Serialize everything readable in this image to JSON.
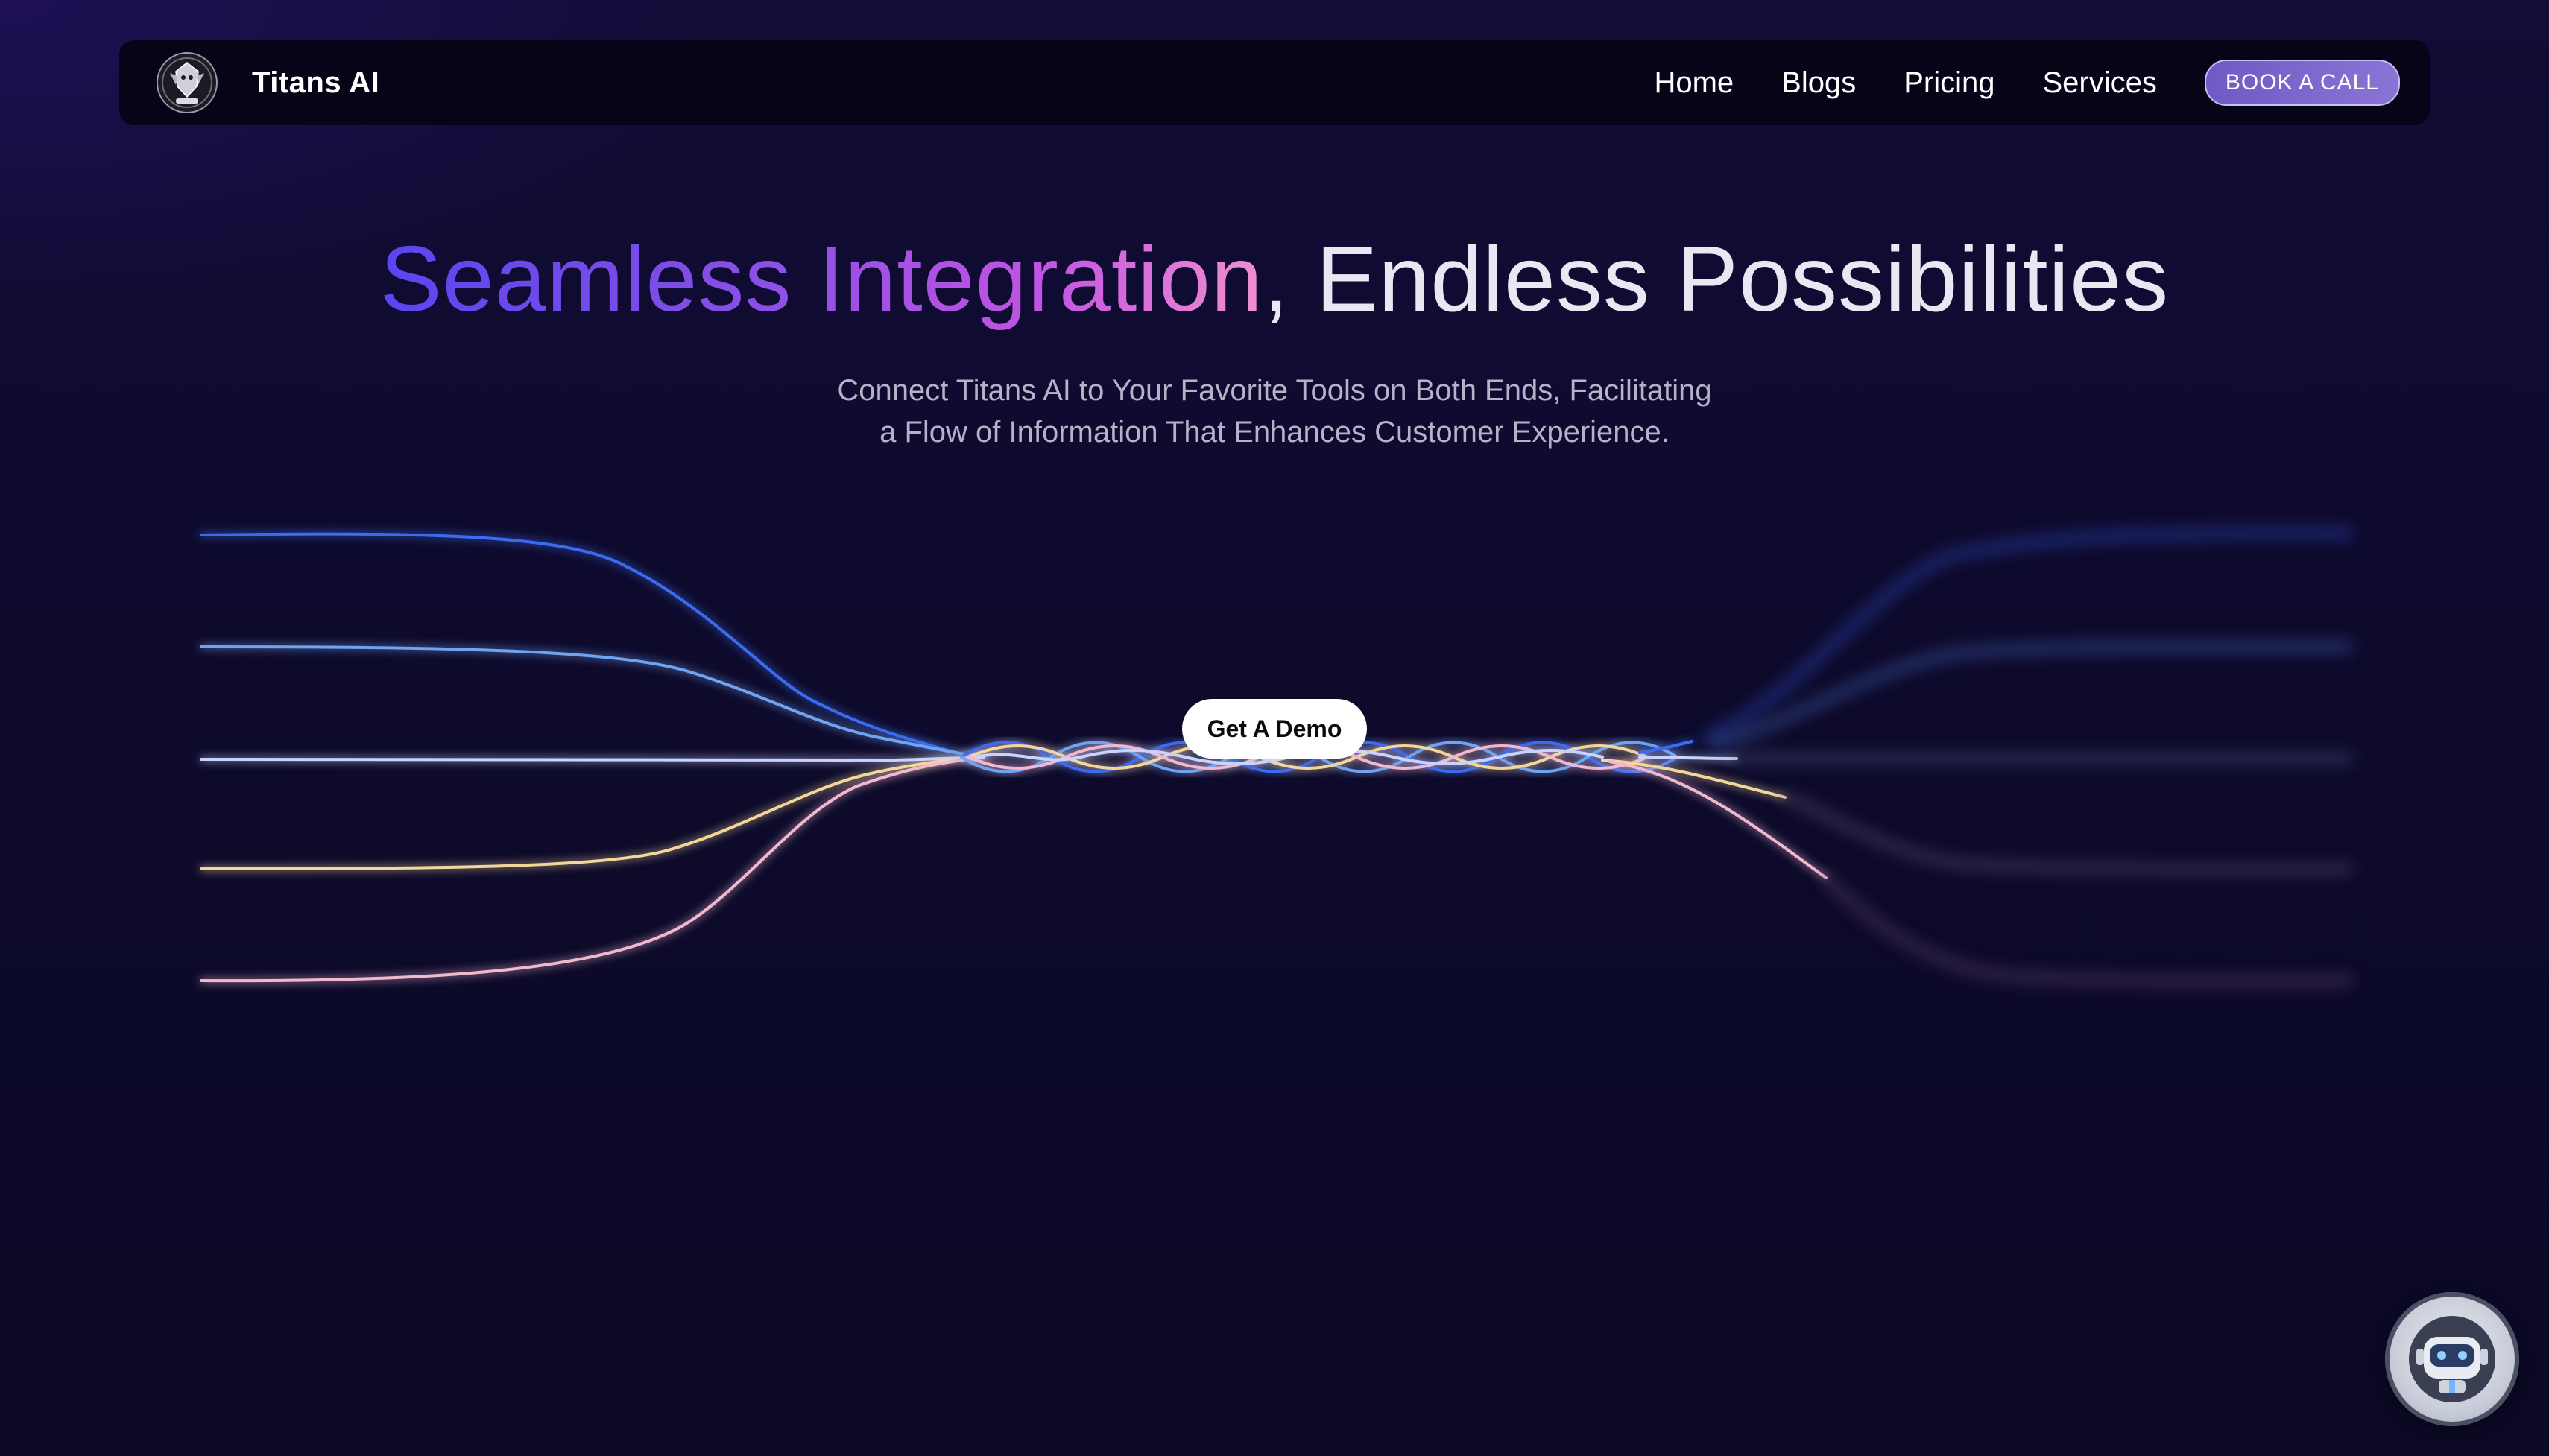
{
  "navbar": {
    "brand_name": "Titans AI",
    "logo_icon": "titans-crest-logo",
    "links": [
      "Home",
      "Blogs",
      "Pricing",
      "Services"
    ],
    "cta_label": "BOOK A CALL"
  },
  "hero": {
    "title_highlight": "Seamless Integration",
    "title_rest": ", Endless Possibilities",
    "subtitle_line1": "Connect Titans AI to Your Favorite Tools on Both Ends, Facilitating",
    "subtitle_line2": "a Flow of Information That Enhances Customer Experience."
  },
  "demo_button": {
    "label": "Get A Demo"
  },
  "chat_widget": {
    "icon": "robot-icon"
  },
  "colors": {
    "background": "#0e0a2a",
    "nav_background": "#060518",
    "accent_purple": "#7e4ee6",
    "gradient_start": "#5b45f0",
    "gradient_end": "#f28fd0",
    "line_blue": "#3a6cf0",
    "line_lightblue": "#6fa3f0",
    "line_white": "#c9d3ff",
    "line_yellow": "#f3d69a",
    "line_pink": "#f2b8d0"
  }
}
